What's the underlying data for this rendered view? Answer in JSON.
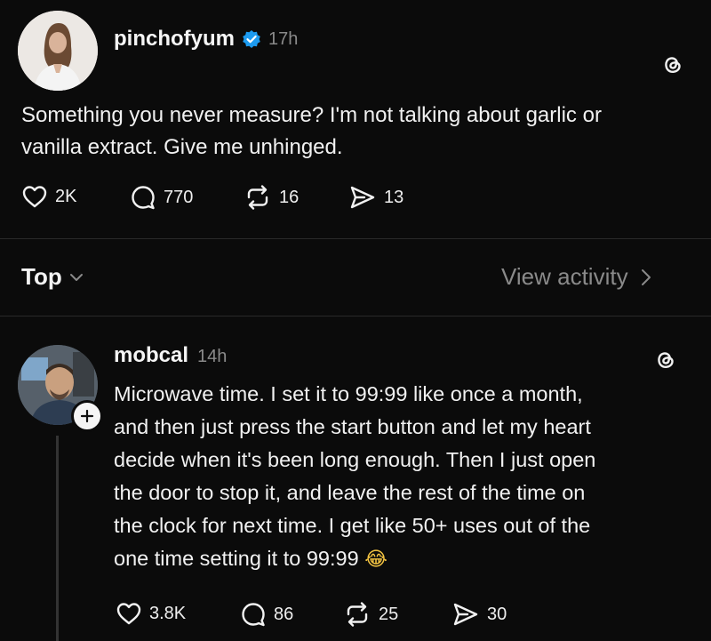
{
  "post": {
    "username": "pinchofyum",
    "time": "17h",
    "text_line1": "Something you never measure? I'm not talking about garlic or",
    "text_line2": "vanilla extract. Give me unhinged.",
    "likes": "2K",
    "comments": "770",
    "reposts": "16",
    "shares": "13"
  },
  "sort": {
    "label": "Top",
    "view_activity": "View activity"
  },
  "reply": {
    "username": "mobcal",
    "time": "14h",
    "lines": [
      "Microwave time. I set it to 99:99 like once a month,",
      "and then just press the start button and let my heart",
      "decide when it's been long enough. Then I just open",
      "the door to stop it, and leave the rest of the time on",
      "the clock for next time. I get like 50+ uses out of the",
      "one time setting it to 99:99"
    ],
    "emoji": "😂",
    "likes": "3.8K",
    "comments": "86",
    "reposts": "25",
    "shares": "30"
  },
  "colors": {
    "background": "#0b0b0b",
    "verified": "#1d9bf0",
    "muted": "#8a8a8a"
  }
}
